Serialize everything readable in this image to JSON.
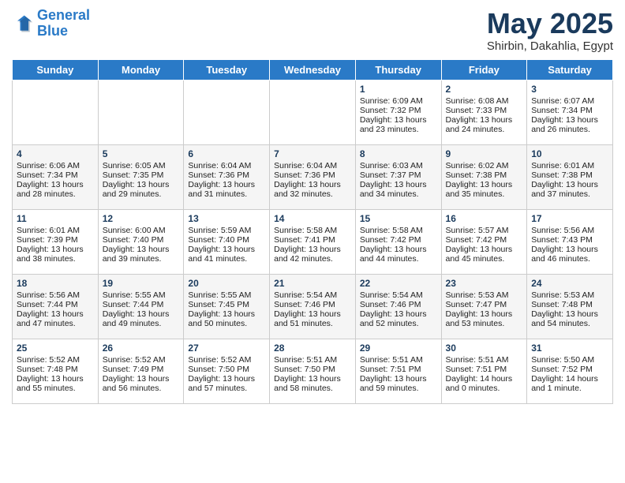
{
  "header": {
    "logo_general": "General",
    "logo_blue": "Blue",
    "month_title": "May 2025",
    "subtitle": "Shirbin, Dakahlia, Egypt"
  },
  "days_of_week": [
    "Sunday",
    "Monday",
    "Tuesday",
    "Wednesday",
    "Thursday",
    "Friday",
    "Saturday"
  ],
  "weeks": [
    [
      {
        "day": "",
        "content": ""
      },
      {
        "day": "",
        "content": ""
      },
      {
        "day": "",
        "content": ""
      },
      {
        "day": "",
        "content": ""
      },
      {
        "day": "1",
        "content": "Sunrise: 6:09 AM\nSunset: 7:32 PM\nDaylight: 13 hours\nand 23 minutes."
      },
      {
        "day": "2",
        "content": "Sunrise: 6:08 AM\nSunset: 7:33 PM\nDaylight: 13 hours\nand 24 minutes."
      },
      {
        "day": "3",
        "content": "Sunrise: 6:07 AM\nSunset: 7:34 PM\nDaylight: 13 hours\nand 26 minutes."
      }
    ],
    [
      {
        "day": "4",
        "content": "Sunrise: 6:06 AM\nSunset: 7:34 PM\nDaylight: 13 hours\nand 28 minutes."
      },
      {
        "day": "5",
        "content": "Sunrise: 6:05 AM\nSunset: 7:35 PM\nDaylight: 13 hours\nand 29 minutes."
      },
      {
        "day": "6",
        "content": "Sunrise: 6:04 AM\nSunset: 7:36 PM\nDaylight: 13 hours\nand 31 minutes."
      },
      {
        "day": "7",
        "content": "Sunrise: 6:04 AM\nSunset: 7:36 PM\nDaylight: 13 hours\nand 32 minutes."
      },
      {
        "day": "8",
        "content": "Sunrise: 6:03 AM\nSunset: 7:37 PM\nDaylight: 13 hours\nand 34 minutes."
      },
      {
        "day": "9",
        "content": "Sunrise: 6:02 AM\nSunset: 7:38 PM\nDaylight: 13 hours\nand 35 minutes."
      },
      {
        "day": "10",
        "content": "Sunrise: 6:01 AM\nSunset: 7:38 PM\nDaylight: 13 hours\nand 37 minutes."
      }
    ],
    [
      {
        "day": "11",
        "content": "Sunrise: 6:01 AM\nSunset: 7:39 PM\nDaylight: 13 hours\nand 38 minutes."
      },
      {
        "day": "12",
        "content": "Sunrise: 6:00 AM\nSunset: 7:40 PM\nDaylight: 13 hours\nand 39 minutes."
      },
      {
        "day": "13",
        "content": "Sunrise: 5:59 AM\nSunset: 7:40 PM\nDaylight: 13 hours\nand 41 minutes."
      },
      {
        "day": "14",
        "content": "Sunrise: 5:58 AM\nSunset: 7:41 PM\nDaylight: 13 hours\nand 42 minutes."
      },
      {
        "day": "15",
        "content": "Sunrise: 5:58 AM\nSunset: 7:42 PM\nDaylight: 13 hours\nand 44 minutes."
      },
      {
        "day": "16",
        "content": "Sunrise: 5:57 AM\nSunset: 7:42 PM\nDaylight: 13 hours\nand 45 minutes."
      },
      {
        "day": "17",
        "content": "Sunrise: 5:56 AM\nSunset: 7:43 PM\nDaylight: 13 hours\nand 46 minutes."
      }
    ],
    [
      {
        "day": "18",
        "content": "Sunrise: 5:56 AM\nSunset: 7:44 PM\nDaylight: 13 hours\nand 47 minutes."
      },
      {
        "day": "19",
        "content": "Sunrise: 5:55 AM\nSunset: 7:44 PM\nDaylight: 13 hours\nand 49 minutes."
      },
      {
        "day": "20",
        "content": "Sunrise: 5:55 AM\nSunset: 7:45 PM\nDaylight: 13 hours\nand 50 minutes."
      },
      {
        "day": "21",
        "content": "Sunrise: 5:54 AM\nSunset: 7:46 PM\nDaylight: 13 hours\nand 51 minutes."
      },
      {
        "day": "22",
        "content": "Sunrise: 5:54 AM\nSunset: 7:46 PM\nDaylight: 13 hours\nand 52 minutes."
      },
      {
        "day": "23",
        "content": "Sunrise: 5:53 AM\nSunset: 7:47 PM\nDaylight: 13 hours\nand 53 minutes."
      },
      {
        "day": "24",
        "content": "Sunrise: 5:53 AM\nSunset: 7:48 PM\nDaylight: 13 hours\nand 54 minutes."
      }
    ],
    [
      {
        "day": "25",
        "content": "Sunrise: 5:52 AM\nSunset: 7:48 PM\nDaylight: 13 hours\nand 55 minutes."
      },
      {
        "day": "26",
        "content": "Sunrise: 5:52 AM\nSunset: 7:49 PM\nDaylight: 13 hours\nand 56 minutes."
      },
      {
        "day": "27",
        "content": "Sunrise: 5:52 AM\nSunset: 7:50 PM\nDaylight: 13 hours\nand 57 minutes."
      },
      {
        "day": "28",
        "content": "Sunrise: 5:51 AM\nSunset: 7:50 PM\nDaylight: 13 hours\nand 58 minutes."
      },
      {
        "day": "29",
        "content": "Sunrise: 5:51 AM\nSunset: 7:51 PM\nDaylight: 13 hours\nand 59 minutes."
      },
      {
        "day": "30",
        "content": "Sunrise: 5:51 AM\nSunset: 7:51 PM\nDaylight: 14 hours\nand 0 minutes."
      },
      {
        "day": "31",
        "content": "Sunrise: 5:50 AM\nSunset: 7:52 PM\nDaylight: 14 hours\nand 1 minute."
      }
    ]
  ]
}
